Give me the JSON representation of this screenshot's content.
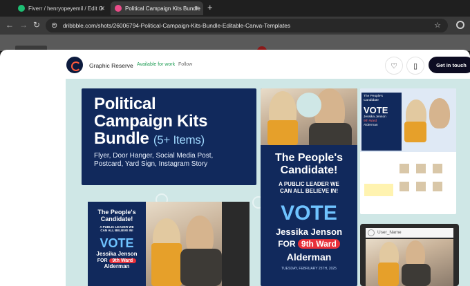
{
  "browser": {
    "tabs": [
      {
        "title": "Fiverr / henryopeyemil / Edit G",
        "active": false,
        "favicon_color": "#1dbf73"
      },
      {
        "title": "Political Campaign Kits Bundle",
        "active": true,
        "favicon_color": "#ea4c89"
      }
    ],
    "new_tab": "+",
    "close": "✕",
    "url": "dribbble.com/shots/26006794-Political-Campaign-Kits-Bundle-Editable-Canva-Templates",
    "nav": {
      "back": "←",
      "forward": "→",
      "reload": "↻",
      "star": "☆",
      "tune": "⊜"
    }
  },
  "shot_header": {
    "designer": "Graphic Reserve",
    "availability": "Available for work",
    "follow": "Follow",
    "like_icon": "♡",
    "save_icon": "▯",
    "cta": "Get in touch"
  },
  "shot": {
    "title_card": {
      "line1": "Political",
      "line2": "Campaign Kits",
      "line3": "Bundle",
      "count": "(5+ Items)",
      "subtitle_1": "Flyer, Door Hanger, Social Media Post,",
      "subtitle_2": "Postcard, Yard Sign, Instagram Story"
    },
    "poster": {
      "headline_1": "The People's",
      "headline_2": "Candidate!",
      "tagline_1": "A PUBLIC LEADER WE",
      "tagline_2": "CAN ALL BELIEVE IN!",
      "vote": "VOTE",
      "candidate": "Jessika Jenson",
      "for": "FOR",
      "ward": "9th Ward",
      "office": "Alderman",
      "date": "TUESDAY, FEBRUARY 25TH, 2025"
    },
    "square": {
      "headline_1": "The People's",
      "headline_2": "Candidate!",
      "tagline_1": "A PUBLIC LEADER WE",
      "tagline_2": "CAN ALL BELIEVE IN!",
      "vote": "VOTE",
      "candidate": "Jessika Jenson",
      "for": "FOR",
      "ward": "9th Ward",
      "office": "Alderman"
    },
    "flyer": {
      "headline_1": "The People's",
      "headline_2": "Candidate",
      "vote": "VOTE",
      "candidate": "Jessika Jenson",
      "ward": "9th Ward",
      "office": "Alderman"
    },
    "instagram": {
      "user": "User_Name"
    }
  },
  "colors": {
    "navy": "#11295c",
    "accent_red": "#e8303a",
    "scarf": "#e6a02a",
    "canvas_bg": "#cfe7e6"
  }
}
